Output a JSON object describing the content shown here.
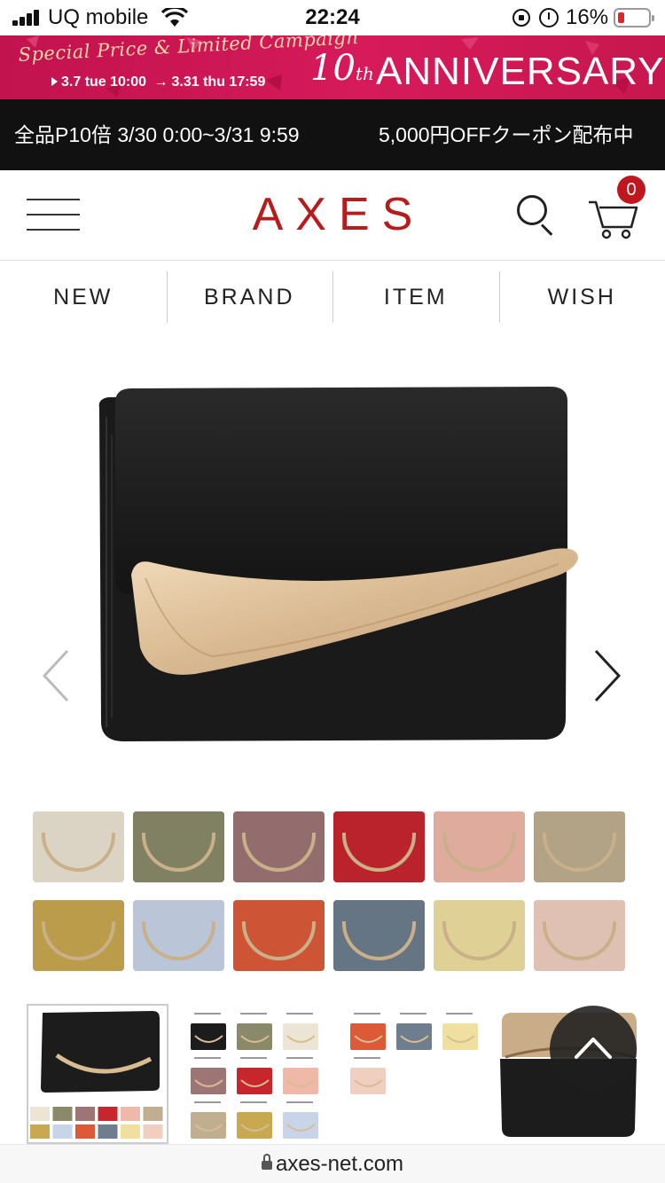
{
  "status_bar": {
    "carrier": "UQ mobile",
    "time": "22:24",
    "battery": "16%"
  },
  "campaign": {
    "script_text": "Special Price & Limited Campaign",
    "date_start": "3.7 tue 10:00",
    "date_end": "3.31 thu 17:59",
    "number": "10",
    "number_suffix": "th",
    "anniversary": "ANNIVERSARY",
    "colors": {
      "background": "#c8174f",
      "script": "#f4d9a9"
    }
  },
  "notice": {
    "left": "全品P10倍 3/30 0:00~3/31 9:59",
    "right": "5,000円OFFクーポン配布中"
  },
  "header": {
    "logo": "AXES",
    "cart_count": "0",
    "colors": {
      "logo": "#b71c1c",
      "badge": "#c0161d"
    }
  },
  "nav": {
    "items": [
      {
        "label": "NEW"
      },
      {
        "label": "BRAND"
      },
      {
        "label": "ITEM"
      },
      {
        "label": "WISH"
      }
    ]
  },
  "product": {
    "main_image": "black-trifold-wallet",
    "swatch_colors": [
      "#ece4d4",
      "#8a8a6a",
      "#9e7575",
      "#c8262e",
      "#f0b8a8",
      "#bfae90",
      "#c8a850",
      "#c8d4e8",
      "#dc5a38",
      "#6e7e8e",
      "#f0e0a0",
      "#f0cfc0"
    ]
  },
  "footer": {
    "url": "axes-net.com"
  }
}
